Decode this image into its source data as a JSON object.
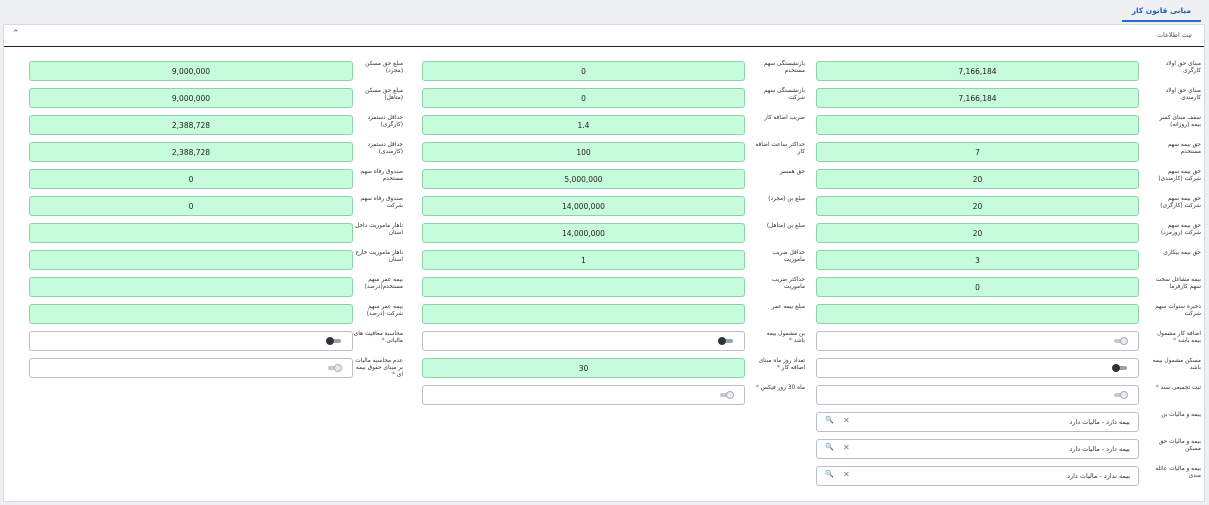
{
  "tab": {
    "label": "مبانی قانون کار"
  },
  "panel": {
    "title": "ثبت اطلاعات",
    "collapse_icon": "chevron-up-icon"
  },
  "fields": [
    {
      "col": "right",
      "row": 0,
      "label": "مبنای حق اولاد کارگری",
      "type": "number",
      "value": "7,166,184"
    },
    {
      "col": "right",
      "row": 1,
      "label": "مبنای حق اولاد کارمندی",
      "type": "number",
      "value": "7,166,184"
    },
    {
      "col": "right",
      "row": 2,
      "label": "سقف مبنای کسر بیمه (روزانه)",
      "type": "number",
      "value": ""
    },
    {
      "col": "right",
      "row": 3,
      "label": "حق بیمه سهم مستخدم",
      "type": "number",
      "value": "7"
    },
    {
      "col": "right",
      "row": 4,
      "label": "حق بیمه سهم شرکت (کارمندی)",
      "type": "number",
      "value": "20"
    },
    {
      "col": "right",
      "row": 5,
      "label": "حق بیمه سهم شرکت (کارگری)",
      "type": "number",
      "value": "20"
    },
    {
      "col": "right",
      "row": 6,
      "label": "حق بیمه سهم شرکت (روزمزد)",
      "type": "number",
      "value": "20"
    },
    {
      "col": "right",
      "row": 7,
      "label": "حق بیمه بیکاری",
      "type": "number",
      "value": "3"
    },
    {
      "col": "right",
      "row": 8,
      "label": "بیمه مشاغل سخت سهم کارفرما",
      "type": "number",
      "value": "0"
    },
    {
      "col": "right",
      "row": 9,
      "label": "ذخیره سنوات سهم شرکت",
      "type": "number",
      "value": ""
    },
    {
      "col": "right",
      "row": 10,
      "label": "اضافه کار مشمول بیمه باشد",
      "required": true,
      "type": "switch",
      "on": false
    },
    {
      "col": "right",
      "row": 11,
      "label": "مسکن مشمول بیمه باشد",
      "type": "switch",
      "on": true
    },
    {
      "col": "right",
      "row": 12,
      "label": "ثبت تجمیعی سند",
      "required": true,
      "type": "switch",
      "on": false
    },
    {
      "col": "middle",
      "row": 0,
      "label": "بازنشستگی سهم مستخدم",
      "type": "number",
      "value": "0"
    },
    {
      "col": "middle",
      "row": 1,
      "label": "بازنشستگی سهم شرکت",
      "type": "number",
      "value": "0"
    },
    {
      "col": "middle",
      "row": 2,
      "label": "ضریب اضافه کار",
      "type": "number",
      "value": "1.4"
    },
    {
      "col": "middle",
      "row": 3,
      "label": "حداکثر ساعت اضافه کار",
      "type": "number",
      "value": "100"
    },
    {
      "col": "middle",
      "row": 4,
      "label": "حق همسر",
      "type": "number",
      "value": "5,000,000"
    },
    {
      "col": "middle",
      "row": 5,
      "label": "مبلغ بن (مجرد)",
      "type": "number",
      "value": "14,000,000"
    },
    {
      "col": "middle",
      "row": 6,
      "label": "مبلغ بن (متاهل)",
      "type": "number",
      "value": "14,000,000"
    },
    {
      "col": "middle",
      "row": 7,
      "label": "حداقل ضریب ماموریت",
      "type": "number",
      "value": "1"
    },
    {
      "col": "middle",
      "row": 8,
      "label": "حداکثر ضریب ماموریت",
      "type": "number",
      "value": ""
    },
    {
      "col": "middle",
      "row": 9,
      "label": "مبلغ بیمه عمر",
      "type": "number",
      "value": ""
    },
    {
      "col": "middle",
      "row": 10,
      "label": "بن مشمول بیمه باشد",
      "required": true,
      "type": "switch",
      "on": true
    },
    {
      "col": "middle",
      "row": 11,
      "label": "تعداد روز ماه مبنای اضافه کار",
      "required": true,
      "type": "number",
      "value": "30"
    },
    {
      "col": "middle",
      "row": 12,
      "label": "ماه 30 روز فیکس",
      "required": true,
      "type": "switch",
      "on": false
    },
    {
      "col": "left",
      "row": 0,
      "label": "مبلغ حق مسکن (مجرد)",
      "type": "number",
      "value": "9,000,000"
    },
    {
      "col": "left",
      "row": 1,
      "label": "مبلغ حق مسکن (متاهل)",
      "type": "number",
      "value": "9,000,000"
    },
    {
      "col": "left",
      "row": 2,
      "label": "حداقل دستمزد (کارگری)",
      "type": "number",
      "value": "2,388,728"
    },
    {
      "col": "left",
      "row": 3,
      "label": "حداقل دستمزد (کارمندی)",
      "type": "number",
      "value": "2,388,728"
    },
    {
      "col": "left",
      "row": 4,
      "label": "صندوق رفاه سهم مستخدم",
      "type": "number",
      "value": "0"
    },
    {
      "col": "left",
      "row": 5,
      "label": "صندوق رفاه سهم شرکت",
      "type": "number",
      "value": "0"
    },
    {
      "col": "left",
      "row": 6,
      "label": "ناهار ماموریت داخل استان",
      "type": "number",
      "value": ""
    },
    {
      "col": "left",
      "row": 7,
      "label": "ناهار ماموریت خارج استان",
      "type": "number",
      "value": ""
    },
    {
      "col": "left",
      "row": 8,
      "label": "بیمه عمر سهم مستخدم(درصد)",
      "type": "number",
      "value": ""
    },
    {
      "col": "left",
      "row": 9,
      "label": "بیمه عمر سهم شرکت (درصد)",
      "type": "number",
      "value": ""
    },
    {
      "col": "left",
      "row": 10,
      "label": "محاسبه معافیت های مالیاتی",
      "required": true,
      "type": "switch",
      "on": true
    },
    {
      "col": "left",
      "row": 11,
      "label": "عدم محاسبه مالیات بر مبنای حقوق بیمه ای",
      "required": true,
      "type": "switch",
      "on": false
    }
  ],
  "lookups": [
    {
      "row": 13,
      "label": "بیمه و مالیات بن",
      "value": "بیمه دارد - مالیات دارد"
    },
    {
      "row": 14,
      "label": "بیمه و مالیات حق مسکن",
      "value": "بیمه دارد - مالیات دارد"
    },
    {
      "row": 15,
      "label": "بیمه و مالیات عائله مندی",
      "value": "بیمه ندارد - مالیات دارد"
    }
  ],
  "icons": {
    "search": "search-icon",
    "clear": "clear-icon"
  }
}
